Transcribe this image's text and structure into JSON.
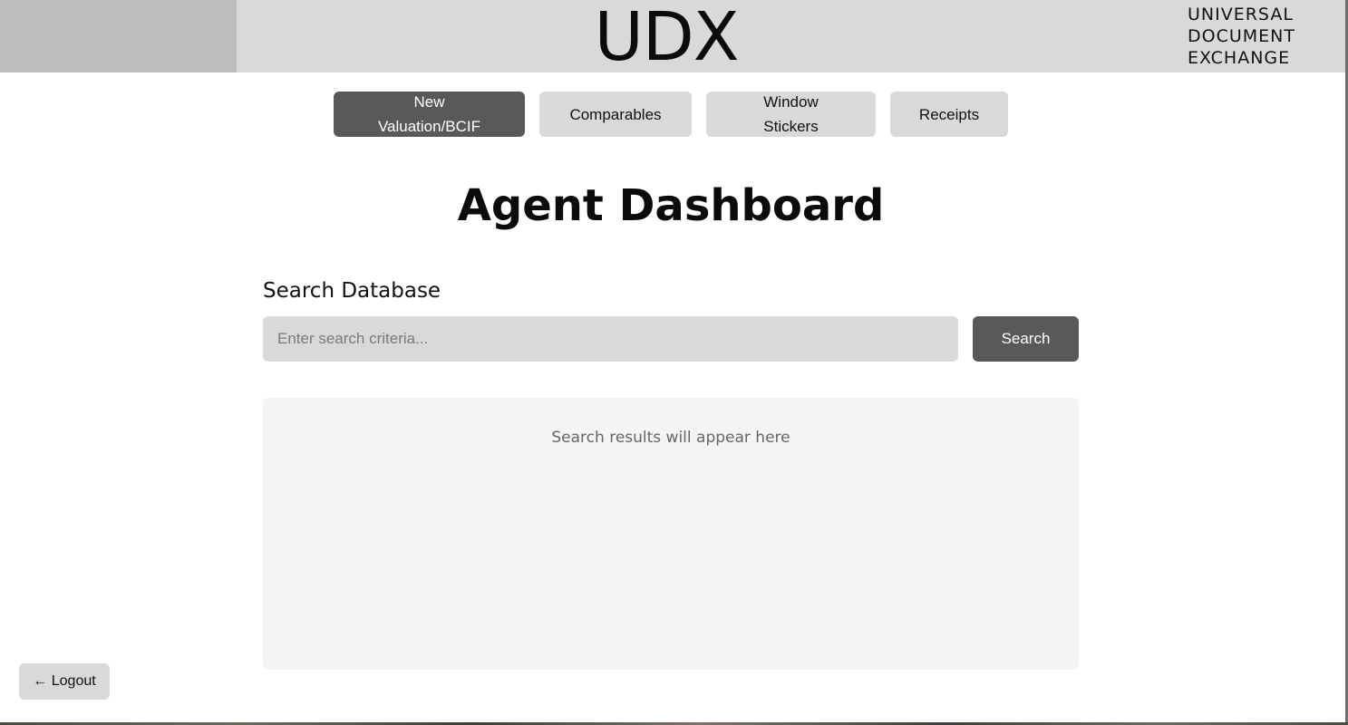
{
  "header": {
    "logo": "UDX",
    "tagline": [
      "UNIVERSAL",
      "DOCUMENT",
      "EXCHANGE"
    ]
  },
  "nav": {
    "new_valuation": [
      "New",
      "Valuation/BCIF"
    ],
    "comparables": "Comparables",
    "window_stickers": [
      "Window",
      "Stickers"
    ],
    "receipts": "Receipts",
    "active": "New Valuation/BCIF"
  },
  "main": {
    "title": "Agent Dashboard",
    "search_heading": "Search Database",
    "search_placeholder": "Enter search criteria...",
    "search_button": "Search",
    "results_placeholder": "Search results will appear here"
  },
  "footer": {
    "logout_label": "← Logout"
  },
  "colors": {
    "header_bg": "#d9d9d9",
    "header_left_block": "#bdbdbd",
    "active_button": "#595959",
    "inactive_button": "#d9d9d9",
    "results_bg": "#f4f4f4"
  }
}
